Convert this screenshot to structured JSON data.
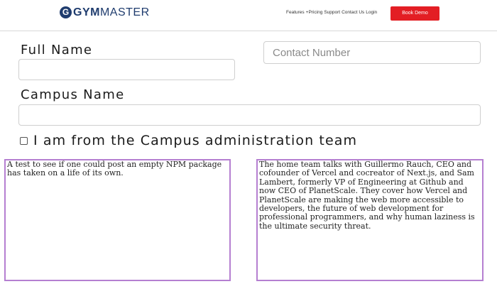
{
  "header": {
    "logo_letter": "G",
    "logo_text_bold": "GYM",
    "logo_text_regular": "MASTER",
    "nav": {
      "features": "Features",
      "pricing": "+Pricing",
      "support": "Support",
      "contact": "Contact Us",
      "login": "Login"
    },
    "book_demo": "Book Demo"
  },
  "form": {
    "full_name_label": "Full Name",
    "full_name_value": "",
    "contact_placeholder": "Contact Number",
    "campus_label": "Campus Name",
    "campus_value": "",
    "checkbox_label": "I am from the Campus administration team",
    "checkbox_checked": false
  },
  "textareas": {
    "left": "A test to see if one could post an empty NPM package has taken on a life of its own.",
    "right": "The home team talks with Guillermo Rauch, CEO and cofounder of Vercel and cocreator of Next.js, and Sam Lambert, formerly VP of Engineering at Github and now CEO of PlanetScale. They cover how Vercel and PlanetScale are making the web more accessible to developers, the future of web development for professional programmers, and why human laziness is the ultimate security threat."
  },
  "colors": {
    "brand": "#1f3c6e",
    "cta": "#e31e24",
    "textarea_border": "#b57fd1"
  }
}
